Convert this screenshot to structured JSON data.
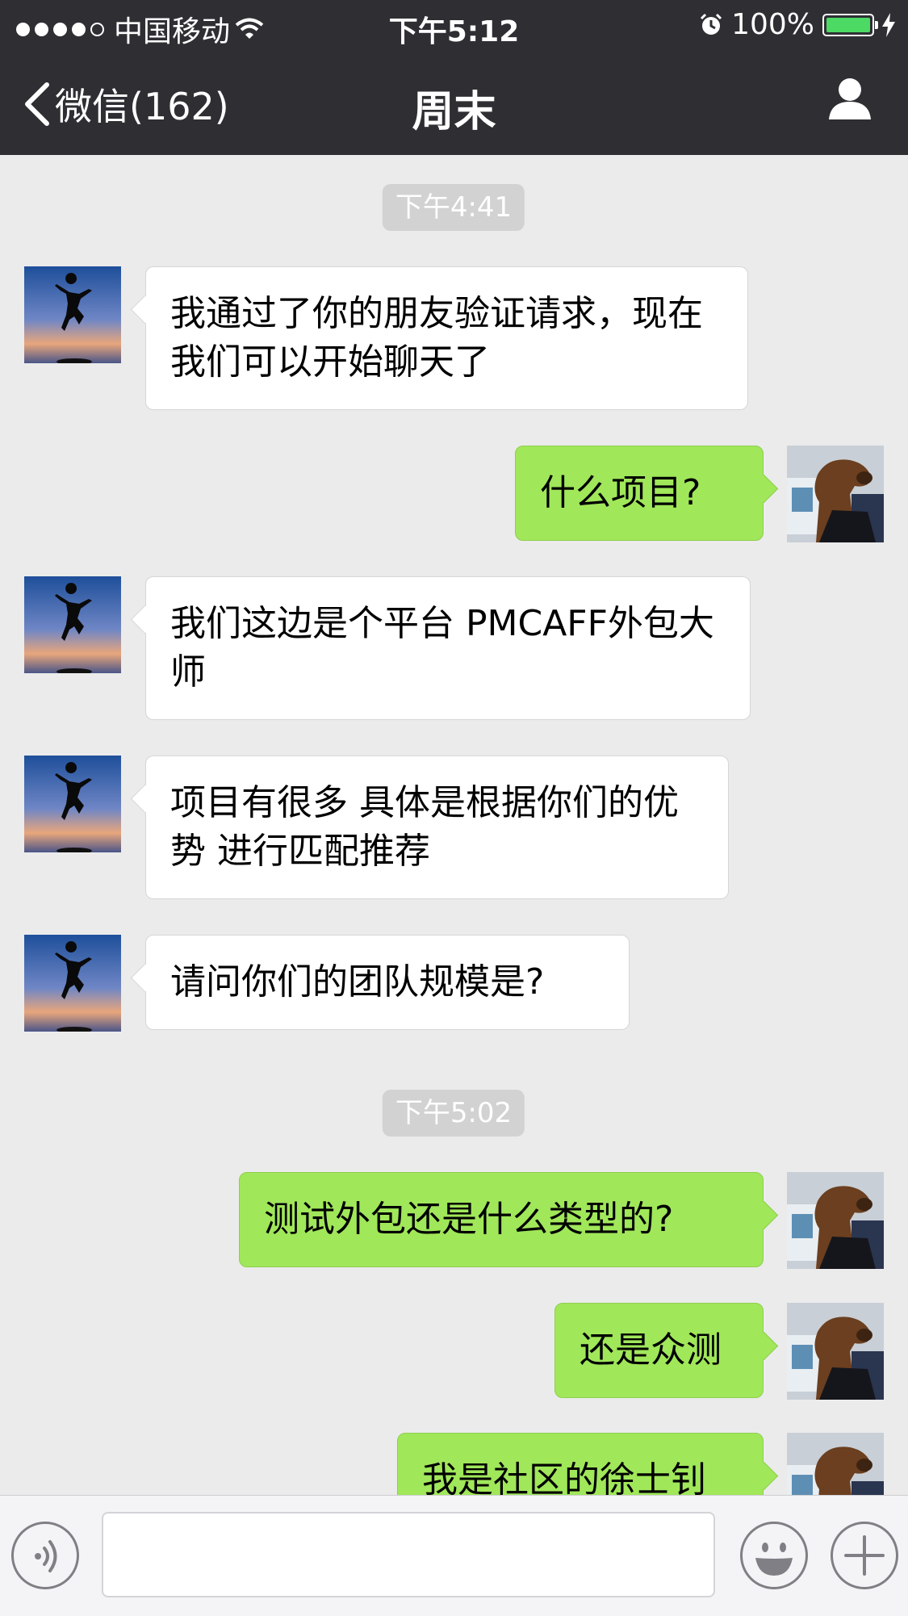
{
  "status_bar": {
    "carrier": "中国移动",
    "time": "下午5:12",
    "battery": "100%",
    "battery_level_percent": 100,
    "signal_bars": 4,
    "signal_bars_max": 5
  },
  "nav": {
    "back_label": "微信(162)",
    "title": "周末"
  },
  "chat": {
    "timestamps": [
      "下午4:41",
      "下午5:02"
    ],
    "messages": [
      {
        "side": "in",
        "text": "我通过了你的朋友验证请求，现在我们可以开始聊天了"
      },
      {
        "side": "out",
        "text": "什么项目?"
      },
      {
        "side": "in",
        "text": "我们这边是个平台 PMCAFF外包大师"
      },
      {
        "side": "in",
        "text": "项目有很多  具体是根据你们的优势 进行匹配推荐"
      },
      {
        "side": "in",
        "text": "请问你们的团队规模是?"
      },
      {
        "side": "out",
        "text": "测试外包还是什么类型的?"
      },
      {
        "side": "out",
        "text": "还是众测"
      },
      {
        "side": "out",
        "text": "我是社区的徐士钊"
      }
    ]
  },
  "input_bar": {
    "voice_icon": "voice-icon",
    "emoji_icon": "emoji-icon",
    "plus_icon": "plus-icon",
    "text_value": ""
  },
  "colors": {
    "header_bg": "#2e2e33",
    "chat_bg": "#ebebeb",
    "bubble_out": "#a0e75a",
    "bubble_in": "#ffffff",
    "timestamp_bg": "#d2d2d2",
    "battery": "#4cd964"
  }
}
